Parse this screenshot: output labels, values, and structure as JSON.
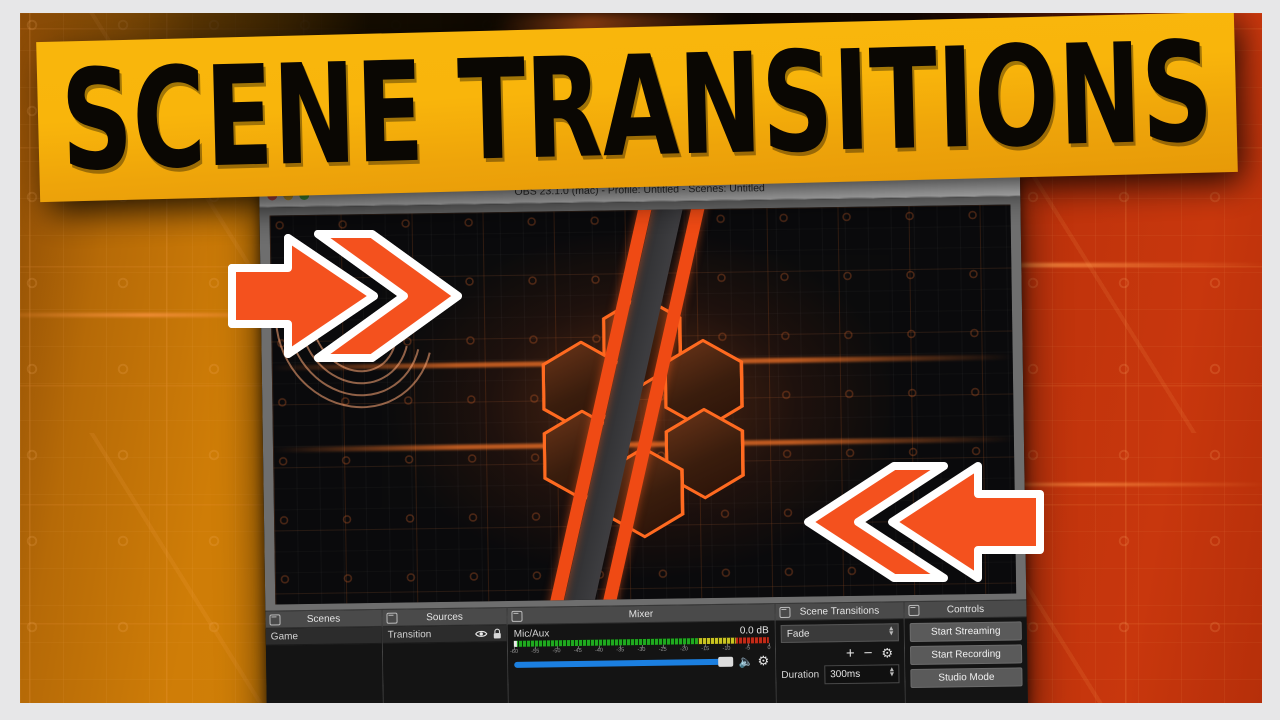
{
  "banner": {
    "title": "SCENE TRANSITIONS",
    "bg_color": "#f9b50b",
    "text_color": "#0a0703"
  },
  "background": {
    "left_color": "#cf7d07",
    "right_color": "#bf330c",
    "accent": "#ef4a14"
  },
  "obs": {
    "title": "OBS 23.1.0 (mac) - Profile: Untitled - Scenes: Untitled",
    "traffic_lights": [
      "close-red",
      "minimize-yellow",
      "zoom-green"
    ],
    "preview": {
      "description": "dark circuit board background with orange neon hexagon cluster and diagonal stripes"
    },
    "docks": {
      "scenes": {
        "title": "Scenes",
        "items": [
          {
            "label": "Game"
          }
        ]
      },
      "sources": {
        "title": "Sources",
        "items": [
          {
            "label": "Transition",
            "eye": "eye-icon",
            "lock": "lock-icon"
          }
        ]
      },
      "mixer": {
        "title": "Mixer",
        "channels": [
          {
            "name": "Mic/Aux",
            "level": "0.0 dB",
            "scale_labels": [
              "-60",
              "-55",
              "-50",
              "-45",
              "-40",
              "-35",
              "-30",
              "-25",
              "-20",
              "-15",
              "-10",
              "-5",
              "0"
            ],
            "volume_percent": 94,
            "mute_icon": "mute-icon",
            "gear_icon": "gear-icon"
          }
        ]
      },
      "scene_transitions": {
        "title": "Scene Transitions",
        "selected": "Fade",
        "add_label": "+",
        "remove_label": "−",
        "properties_icon": "gear-icon",
        "duration_label": "Duration",
        "duration_value": "300ms"
      },
      "controls": {
        "title": "Controls",
        "buttons": [
          {
            "label": "Start Streaming"
          },
          {
            "label": "Start Recording"
          },
          {
            "label": "Studio Mode"
          }
        ]
      }
    }
  },
  "annotations": {
    "left_arrow": {
      "name": "right-pointing-arrow",
      "color": "#f4511e",
      "outline": "#ffffff"
    },
    "right_arrow": {
      "name": "left-pointing-arrow",
      "color": "#f4511e",
      "outline": "#ffffff"
    }
  }
}
